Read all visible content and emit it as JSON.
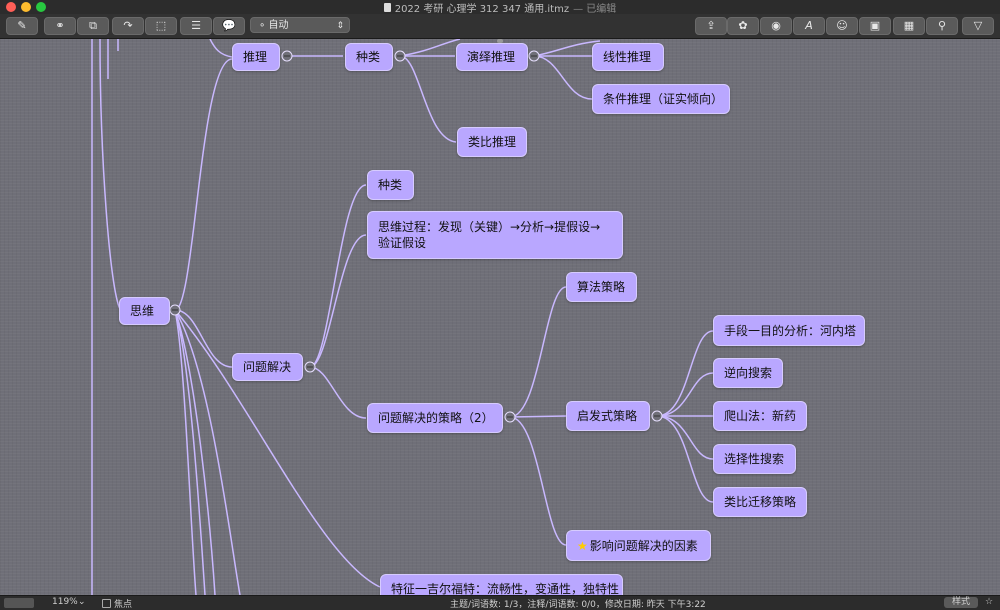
{
  "window": {
    "title": "2022 考研 心理学  312 347 通用.itmz",
    "status": "— 已编辑"
  },
  "toolbar": {
    "left_icons": [
      "new-topic-icon",
      "link-icon",
      "shapes-icon",
      "relationship-icon",
      "boundary-icon",
      "notes-icon",
      "callout-icon"
    ],
    "layout_select": "自动",
    "right_icons": [
      "share-icon",
      "style-icon",
      "color-icon",
      "font-icon",
      "emoji-icon",
      "image-icon",
      "table-icon",
      "search-icon",
      "filter-icon"
    ]
  },
  "mindmap": {
    "nodes": {
      "siwei": "思维",
      "tuili": "推理",
      "zhonglei_1": "种类",
      "yanyi": "演绎推理",
      "xianxing": "线性推理",
      "tiaojian": "条件推理（证实倾向）",
      "leibi": "类比推理",
      "zhonglei_2": "种类",
      "guocheng": "思维过程：发现（关键）→分析→提假设→验证假设",
      "wenti": "问题解决",
      "celue": "问题解决的策略（2）",
      "suanfa": "算法策略",
      "qifa": "启发式策略",
      "shouduan": "手段一目的分析：河内塔",
      "nixiang": "逆向搜索",
      "pashan": "爬山法：新药",
      "xuanze": "选择性搜索",
      "leibiqianyi": "类比迁移策略",
      "yingxiang": "影响问题解决的因素",
      "tezheng": "特征一吉尔福特：流畅性，变通性，独特性"
    }
  },
  "statusbar": {
    "zoom": "119%",
    "focus": "焦点",
    "stats": "主题/词语数: 1/3，注释/词语数: 0/0，修改日期: 昨天 下午3:22",
    "style_button": "样式"
  },
  "colors": {
    "node_fill": "#b9a7ff",
    "link": "#c9b8ff",
    "canvas": "#6f6f78"
  }
}
